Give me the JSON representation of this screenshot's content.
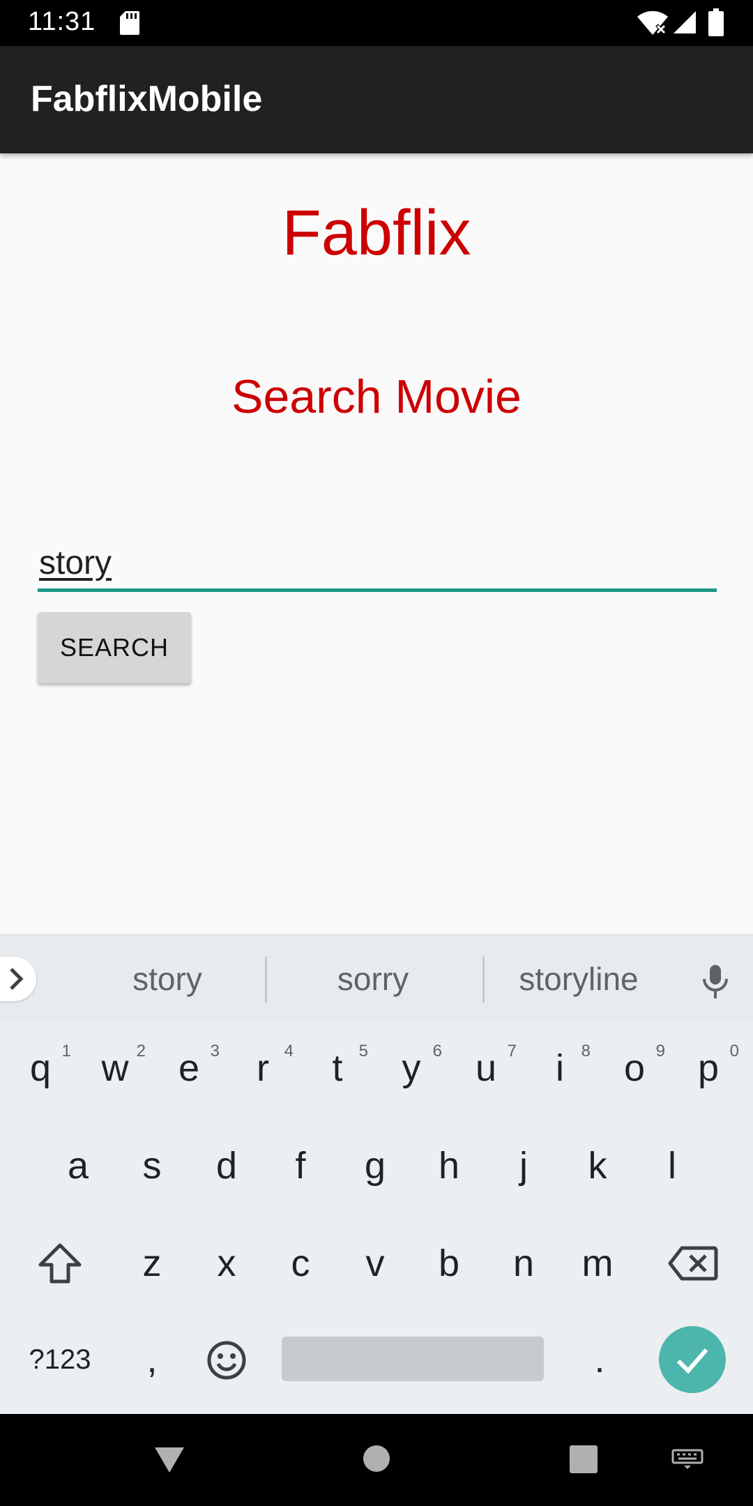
{
  "status_bar": {
    "time": "11:31"
  },
  "app_bar": {
    "title": "FabflixMobile"
  },
  "main": {
    "brand_title": "Fabflix",
    "heading": "Search Movie",
    "search_value": "story",
    "search_button_label": "SEARCH"
  },
  "keyboard": {
    "suggestions": [
      "story",
      "sorry",
      "storyline"
    ],
    "row1": [
      {
        "k": "q",
        "h": "1"
      },
      {
        "k": "w",
        "h": "2"
      },
      {
        "k": "e",
        "h": "3"
      },
      {
        "k": "r",
        "h": "4"
      },
      {
        "k": "t",
        "h": "5"
      },
      {
        "k": "y",
        "h": "6"
      },
      {
        "k": "u",
        "h": "7"
      },
      {
        "k": "i",
        "h": "8"
      },
      {
        "k": "o",
        "h": "9"
      },
      {
        "k": "p",
        "h": "0"
      }
    ],
    "row2": [
      "a",
      "s",
      "d",
      "f",
      "g",
      "h",
      "j",
      "k",
      "l"
    ],
    "row3": [
      "z",
      "x",
      "c",
      "v",
      "b",
      "n",
      "m"
    ],
    "symbols_label": "?123",
    "comma": ",",
    "period": "."
  },
  "colors": {
    "brand_red": "#cc0000",
    "accent_teal": "#1a9688",
    "enter_key": "#4db6ac",
    "app_bar": "#212121"
  }
}
